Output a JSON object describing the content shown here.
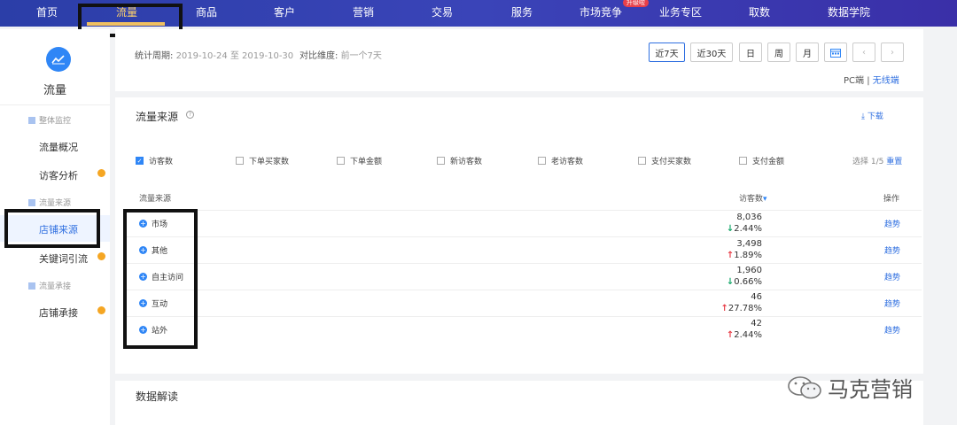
{
  "nav": {
    "items": [
      "首页",
      "流量",
      "商品",
      "客户",
      "营销",
      "交易",
      "服务",
      "市场竞争",
      "业务专区",
      "取数",
      "数据学院"
    ],
    "hot_badge": "升级啦"
  },
  "sidebar": {
    "title": "流量",
    "groups": [
      "整体监控",
      "流量来源",
      "流量承接"
    ],
    "items": [
      "流量概况",
      "访客分析",
      "店铺来源",
      "关键词引流",
      "店铺承接"
    ]
  },
  "period": {
    "label": "统计周期:",
    "value": "2019-10-24 至 2019-10-30",
    "compare_label": "对比维度:",
    "compare_value": "前一个7天",
    "buttons": [
      "近7天",
      "近30天",
      "日",
      "周",
      "月"
    ],
    "pc": "PC端",
    "wireless": "无线端"
  },
  "source": {
    "title": "流量来源",
    "download": "下载",
    "metrics": [
      "访客数",
      "下单买家数",
      "下单金额",
      "新访客数",
      "老访客数",
      "支付买家数",
      "支付金额"
    ],
    "select_info": "选择 1/5",
    "reset": "重置",
    "col_source": "流量来源",
    "col_visitors": "访客数",
    "col_action": "操作",
    "rows": [
      {
        "name": "市场",
        "value": "8,036",
        "change": "2.44%",
        "dir": "down",
        "action": "趋势"
      },
      {
        "name": "其他",
        "value": "3,498",
        "change": "1.89%",
        "dir": "up",
        "action": "趋势"
      },
      {
        "name": "自主访问",
        "value": "1,960",
        "change": "0.66%",
        "dir": "down",
        "action": "趋势"
      },
      {
        "name": "互动",
        "value": "46",
        "change": "27.78%",
        "dir": "up",
        "action": "趋势"
      },
      {
        "name": "站外",
        "value": "42",
        "change": "2.44%",
        "dir": "up",
        "action": "趋势"
      }
    ]
  },
  "interpret": {
    "title": "数据解读"
  },
  "watermark": "马克营销",
  "colors": {
    "nav_bg": "#3a44b8",
    "accent": "#2f6fe0",
    "up": "#e8404a",
    "down": "#1aa86c"
  }
}
